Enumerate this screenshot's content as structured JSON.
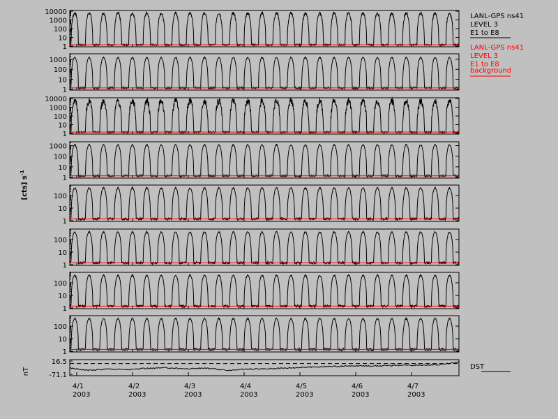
{
  "colors": {
    "background": "#c0c0c0",
    "axis": "#000000",
    "flux_series": "#000000",
    "background_series": "#ff0000"
  },
  "legend": {
    "instrument_black": "LANL-GPS ns41",
    "level_black": "LEVEL 3",
    "channels_black": "E1 to E8",
    "instrument_red": "LANL-GPS ns41",
    "level_red": "LEVEL 3",
    "channels_red": "E1 to E8",
    "background_red": "background",
    "dst_label": "DST"
  },
  "axis_labels": {
    "flux_unit": "[cts] s",
    "flux_unit_exponent": "-1",
    "dst_unit": "nT"
  },
  "chart_data": {
    "type": "line",
    "x_tick_labels": [
      {
        "date": "4/1",
        "year": "2003"
      },
      {
        "date": "4/2",
        "year": "2003"
      },
      {
        "date": "4/3",
        "year": "2003"
      },
      {
        "date": "4/4",
        "year": "2003"
      },
      {
        "date": "4/5",
        "year": "2003"
      },
      {
        "date": "4/6",
        "year": "2003"
      },
      {
        "date": "4/7",
        "year": "2003"
      }
    ],
    "days_shown": 7,
    "panels": [
      {
        "scale": "log",
        "yticks": [
          "10000",
          "1000",
          "100",
          "10",
          "1"
        ],
        "ylim": [
          1,
          10000
        ],
        "peak": 6000,
        "noise": 0.3
      },
      {
        "scale": "log",
        "yticks": [
          "1000",
          "100",
          "10",
          "1"
        ],
        "ylim": [
          1,
          3000
        ],
        "peak": 1500,
        "noise": 0.1
      },
      {
        "scale": "log",
        "yticks": [
          "10000",
          "1000",
          "100",
          "10",
          "1"
        ],
        "ylim": [
          1,
          10000
        ],
        "peak": 5000,
        "noise": 0.8
      },
      {
        "scale": "log",
        "yticks": [
          "1000",
          "100",
          "10",
          "1"
        ],
        "ylim": [
          1,
          2000
        ],
        "peak": 1200,
        "noise": 0.1
      },
      {
        "scale": "log",
        "yticks": [
          "100",
          "10",
          "1"
        ],
        "ylim": [
          1,
          600
        ],
        "peak": 400,
        "noise": 0.1
      },
      {
        "scale": "log",
        "yticks": [
          "100",
          "10",
          "1"
        ],
        "ylim": [
          1,
          600
        ],
        "peak": 400,
        "noise": 0.1
      },
      {
        "scale": "log",
        "yticks": [
          "100",
          "10",
          "1"
        ],
        "ylim": [
          1,
          600
        ],
        "peak": 400,
        "noise": 0.1
      },
      {
        "scale": "log",
        "yticks": [
          "100",
          "10",
          "1"
        ],
        "ylim": [
          1,
          600
        ],
        "peak": 400,
        "noise": 0.1
      }
    ],
    "background_level": 1.4,
    "oscillation_cycles": 27,
    "dst_panel": {
      "scale": "linear",
      "yticks": [
        "16.5",
        "-71.1"
      ],
      "ylim": [
        -71.1,
        16.5
      ],
      "reference_level": 0,
      "trace": [
        [
          0.0,
          -30
        ],
        [
          0.05,
          -45
        ],
        [
          0.1,
          -35
        ],
        [
          0.15,
          -40
        ],
        [
          0.2,
          -32
        ],
        [
          0.25,
          -28
        ],
        [
          0.3,
          -35
        ],
        [
          0.35,
          -30
        ],
        [
          0.4,
          -45
        ],
        [
          0.45,
          -38
        ],
        [
          0.5,
          -35
        ],
        [
          0.55,
          -30
        ],
        [
          0.6,
          -25
        ],
        [
          0.65,
          -20
        ],
        [
          0.7,
          -18
        ],
        [
          0.75,
          -15
        ],
        [
          0.8,
          -15
        ],
        [
          0.85,
          -12
        ],
        [
          0.9,
          -10
        ],
        [
          0.95,
          -8
        ],
        [
          1.0,
          10
        ]
      ]
    }
  }
}
